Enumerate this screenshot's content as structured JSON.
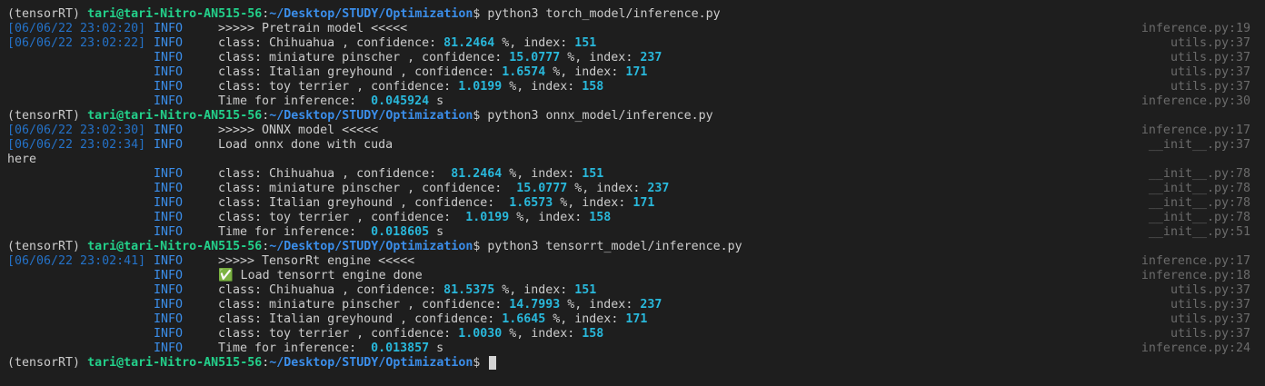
{
  "prompt": {
    "env": "(tensorRT)",
    "user_host": "tari@tari-Nitro-AN515-56",
    "path": "~/Desktop/STUDY/Optimization",
    "dollar": "$"
  },
  "commands": [
    "python3 torch_model/inference.py",
    "python3 onnx_model/inference.py",
    "python3 tensorrt_model/inference.py"
  ],
  "lines": [
    {
      "kind": "prompt",
      "cmd": "python3 torch_model/inference.py"
    },
    {
      "kind": "log",
      "ts": "[06/06/22 23:02:20]",
      "level": "INFO",
      "parts": [
        ">>>>> Pretrain model <<<<<"
      ],
      "src": "inference.py:19"
    },
    {
      "kind": "log",
      "ts": "[06/06/22 23:02:22]",
      "level": "INFO",
      "parts": [
        "class: Chihuahua , confidence: ",
        "81.2464",
        " %, index: ",
        "151"
      ],
      "src": "utils.py:37"
    },
    {
      "kind": "log",
      "ts": "",
      "level": "INFO",
      "parts": [
        "class: miniature pinscher , confidence: ",
        "15.0777",
        " %, index: ",
        "237"
      ],
      "src": "utils.py:37"
    },
    {
      "kind": "log",
      "ts": "",
      "level": "INFO",
      "parts": [
        "class: Italian greyhound , confidence: ",
        "1.6574",
        " %, index: ",
        "171"
      ],
      "src": "utils.py:37"
    },
    {
      "kind": "log",
      "ts": "",
      "level": "INFO",
      "parts": [
        "class: toy terrier , confidence: ",
        "1.0199",
        " %, index: ",
        "158"
      ],
      "src": "utils.py:37"
    },
    {
      "kind": "log",
      "ts": "",
      "level": "INFO",
      "parts": [
        "Time for inference:  ",
        "0.045924",
        " s"
      ],
      "src": "inference.py:30"
    },
    {
      "kind": "prompt",
      "cmd": "python3 onnx_model/inference.py"
    },
    {
      "kind": "log",
      "ts": "[06/06/22 23:02:30]",
      "level": "INFO",
      "parts": [
        ">>>>> ONNX model <<<<<"
      ],
      "src": "inference.py:17"
    },
    {
      "kind": "log",
      "ts": "[06/06/22 23:02:34]",
      "level": "INFO",
      "parts": [
        "Load onnx done with cuda"
      ],
      "src": "__init__.py:37"
    },
    {
      "kind": "plain",
      "text": "here"
    },
    {
      "kind": "log",
      "ts": "",
      "level": "INFO",
      "parts": [
        "class: Chihuahua , confidence:  ",
        "81.2464",
        " %, index: ",
        "151"
      ],
      "src": "__init__.py:78"
    },
    {
      "kind": "log",
      "ts": "",
      "level": "INFO",
      "parts": [
        "class: miniature pinscher , confidence:  ",
        "15.0777",
        " %, index: ",
        "237"
      ],
      "src": "__init__.py:78"
    },
    {
      "kind": "log",
      "ts": "",
      "level": "INFO",
      "parts": [
        "class: Italian greyhound , confidence:  ",
        "1.6573",
        " %, index: ",
        "171"
      ],
      "src": "__init__.py:78"
    },
    {
      "kind": "log",
      "ts": "",
      "level": "INFO",
      "parts": [
        "class: toy terrier , confidence:  ",
        "1.0199",
        " %, index: ",
        "158"
      ],
      "src": "__init__.py:78"
    },
    {
      "kind": "log",
      "ts": "",
      "level": "INFO",
      "parts": [
        "Time for inference:  ",
        "0.018605",
        " s"
      ],
      "src": "__init__.py:51"
    },
    {
      "kind": "prompt",
      "cmd": "python3 tensorrt_model/inference.py"
    },
    {
      "kind": "log",
      "ts": "[06/06/22 23:02:41]",
      "level": "INFO",
      "parts": [
        ">>>>> TensorRt engine <<<<<"
      ],
      "src": "inference.py:17"
    },
    {
      "kind": "log",
      "ts": "",
      "level": "INFO",
      "parts": [
        "✅ Load tensorrt engine done"
      ],
      "src": "inference.py:18"
    },
    {
      "kind": "log",
      "ts": "",
      "level": "INFO",
      "parts": [
        "class: Chihuahua , confidence: ",
        "81.5375",
        " %, index: ",
        "151"
      ],
      "src": "utils.py:37"
    },
    {
      "kind": "log",
      "ts": "",
      "level": "INFO",
      "parts": [
        "class: miniature pinscher , confidence: ",
        "14.7993",
        " %, index: ",
        "237"
      ],
      "src": "utils.py:37"
    },
    {
      "kind": "log",
      "ts": "",
      "level": "INFO",
      "parts": [
        "class: Italian greyhound , confidence: ",
        "1.6645",
        " %, index: ",
        "171"
      ],
      "src": "utils.py:37"
    },
    {
      "kind": "log",
      "ts": "",
      "level": "INFO",
      "parts": [
        "class: toy terrier , confidence: ",
        "1.0030",
        " %, index: ",
        "158"
      ],
      "src": "utils.py:37"
    },
    {
      "kind": "log",
      "ts": "",
      "level": "INFO",
      "parts": [
        "Time for inference:  ",
        "0.013857",
        " s"
      ],
      "src": "inference.py:24"
    },
    {
      "kind": "prompt",
      "cmd": ""
    }
  ],
  "colors": {
    "background": "#1e1e1e",
    "user_host": "#23d18b",
    "path": "#3b8eea",
    "number": "#29b8db",
    "timestamp": "#2472c8",
    "source": "#6b6b6b"
  }
}
